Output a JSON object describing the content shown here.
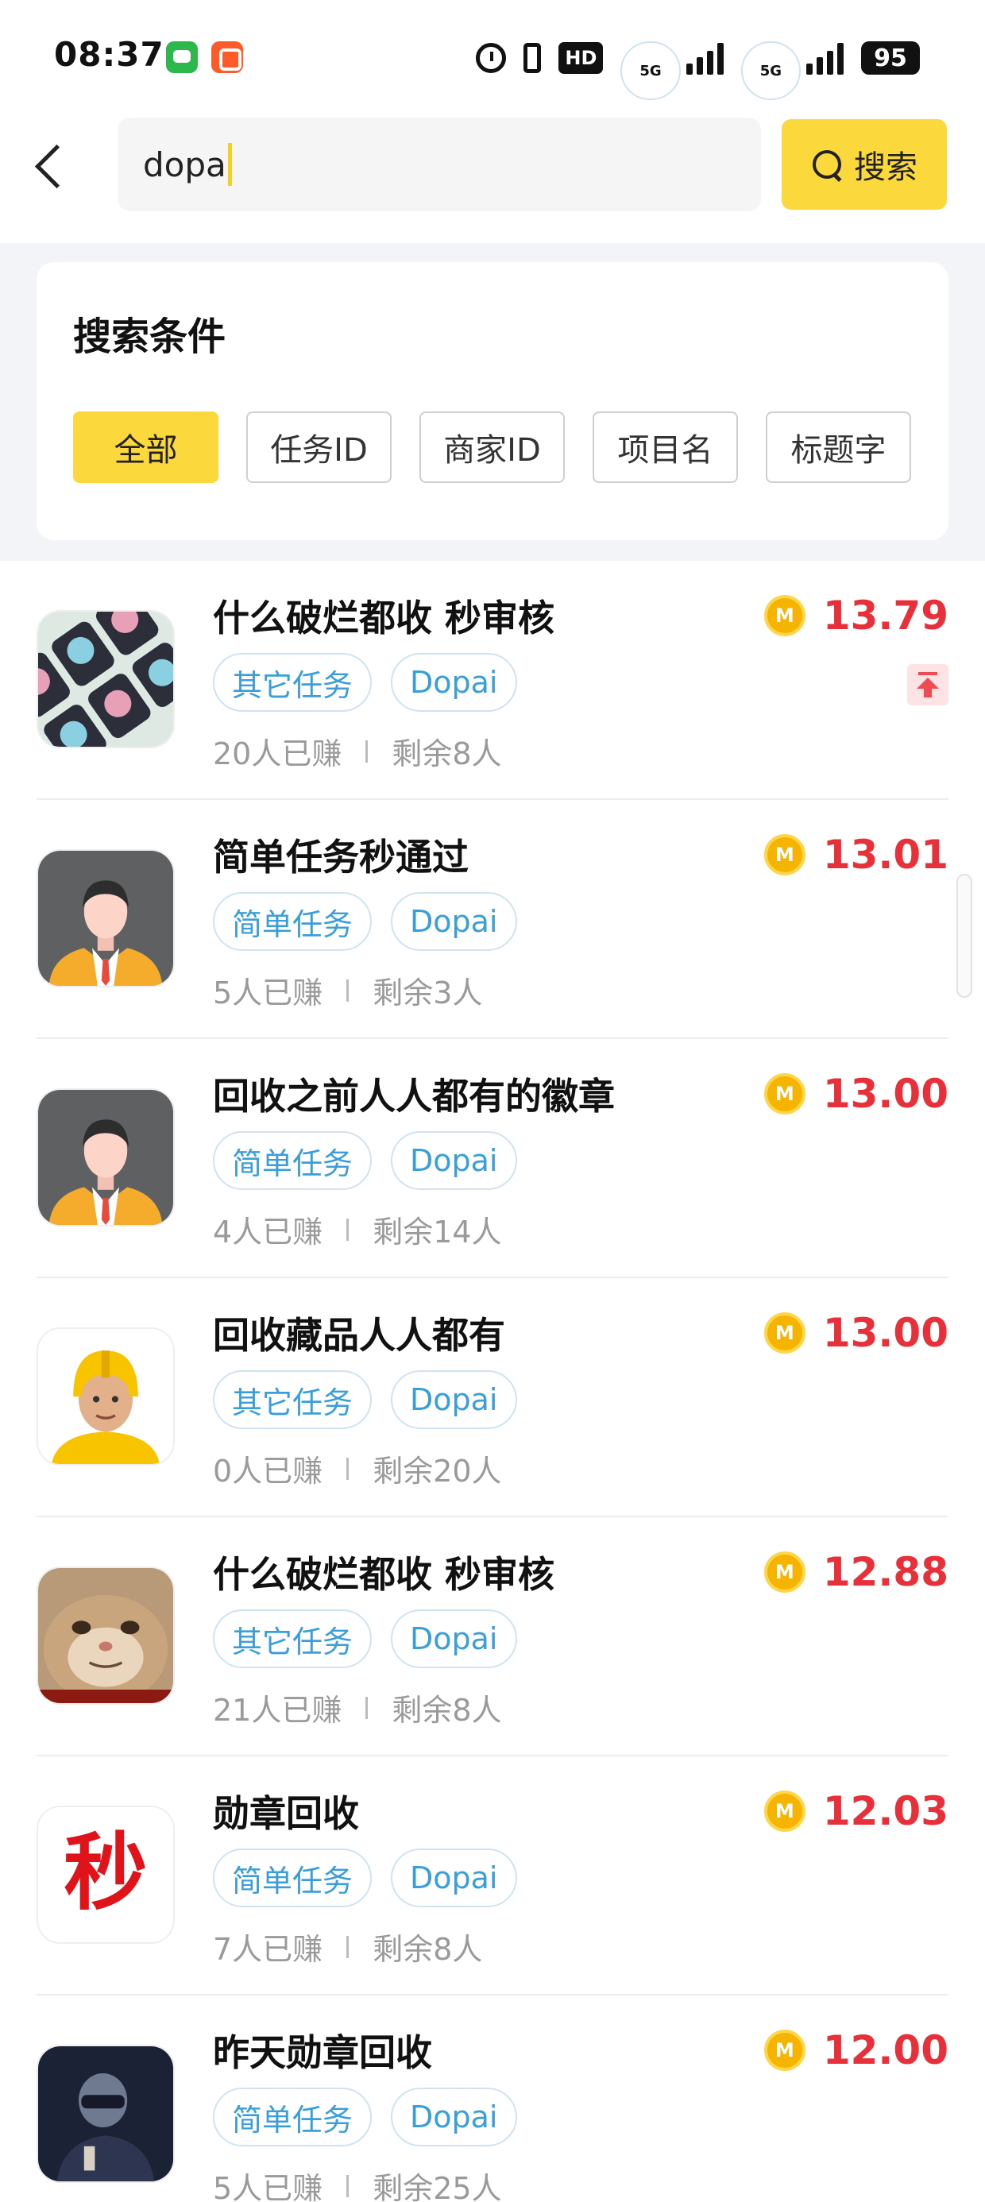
{
  "status_bar": {
    "time": "08:37",
    "icons": [
      "messages-app-icon",
      "shop-app-icon",
      "alarm-icon",
      "vibrate-icon",
      "hd-icon",
      "signal-5g-icon",
      "signal-5g-icon",
      "battery-icon"
    ],
    "hd": "HD",
    "network_1": "5G",
    "network_2": "5G",
    "battery": "95"
  },
  "search": {
    "query": "dopa",
    "button_label": "搜索"
  },
  "filter": {
    "title": "搜索条件",
    "chips": [
      "全部",
      "任务ID",
      "商家ID",
      "项目名",
      "标题字"
    ],
    "active_index": 0
  },
  "colors": {
    "accent_yellow": "#fbd93c",
    "price_red": "#e8303a",
    "tag_blue": "#3a9fd8"
  },
  "tasks": [
    {
      "title": "什么破烂都收 秒审核",
      "tags": [
        "其它任务",
        "Dopai"
      ],
      "earned": "20人已赚",
      "remaining": "剩余8人",
      "price": "13.79",
      "thumb": "anime-grid-avatar",
      "pinned": true
    },
    {
      "title": "简单任务秒通过",
      "tags": [
        "简单任务",
        "Dopai"
      ],
      "earned": "5人已赚",
      "remaining": "剩余3人",
      "price": "13.01",
      "thumb": "default-man-avatar",
      "pinned": false
    },
    {
      "title": "回收之前人人都有的徽章",
      "tags": [
        "简单任务",
        "Dopai"
      ],
      "earned": "4人已赚",
      "remaining": "剩余14人",
      "price": "13.00",
      "thumb": "default-man-avatar",
      "pinned": false
    },
    {
      "title": "回收藏品人人都有",
      "tags": [
        "其它任务",
        "Dopai"
      ],
      "earned": "0人已赚",
      "remaining": "剩余20人",
      "price": "13.00",
      "thumb": "yellow-helmet-avatar",
      "pinned": false
    },
    {
      "title": "什么破烂都收 秒审核",
      "tags": [
        "其它任务",
        "Dopai"
      ],
      "earned": "21人已赚",
      "remaining": "剩余8人",
      "price": "12.88",
      "thumb": "cat-avatar",
      "pinned": false
    },
    {
      "title": "勋章回收",
      "tags": [
        "简单任务",
        "Dopai"
      ],
      "earned": "7人已赚",
      "remaining": "剩余8人",
      "price": "12.03",
      "thumb": "miao-char-avatar",
      "thumb_text": "秒",
      "pinned": false
    },
    {
      "title": "昨天勋章回收",
      "tags": [
        "简单任务",
        "Dopai"
      ],
      "earned": "5人已赚",
      "remaining": "剩余25人",
      "price": "12.00",
      "thumb": "helmet-person-avatar",
      "pinned": false
    }
  ],
  "coin_label": "M"
}
